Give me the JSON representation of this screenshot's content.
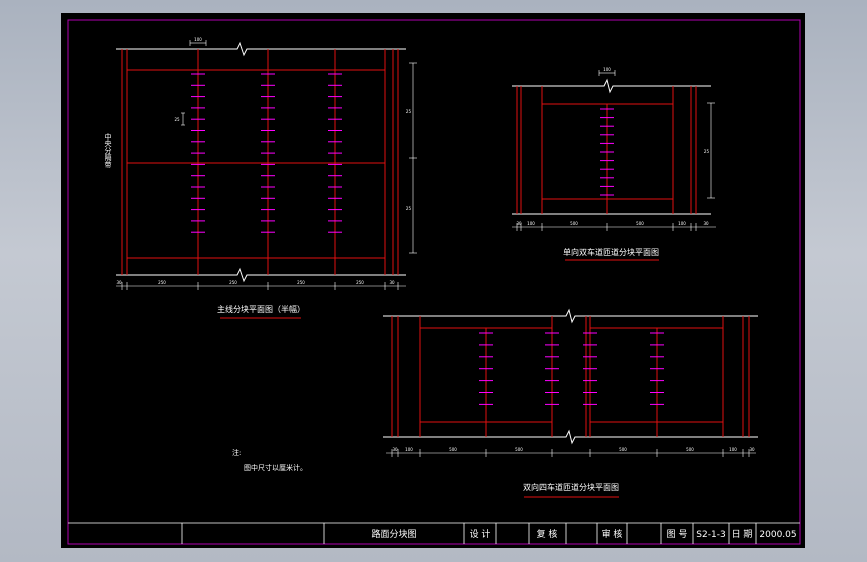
{
  "colors": {
    "background": "#000000",
    "border": "#b000b0",
    "structure": "#e01010",
    "bolts": "#ff00ff",
    "white": "#ffffff"
  },
  "drawings": {
    "main": {
      "caption": "主线分块平面图（半幅）",
      "side_label": "中央分隔带",
      "bolt_spacing_label": "25",
      "top_label": "100",
      "right_dims": [
        "25",
        "25"
      ],
      "bottom_dims": [
        "30",
        "250",
        "250",
        "250",
        "250",
        "30"
      ]
    },
    "single": {
      "caption": "单向双车道匝道分块平面图",
      "top_label": "100",
      "right_dim": "25",
      "bottom_dims": [
        "30",
        "100",
        "500",
        "500",
        "100",
        "30"
      ]
    },
    "double": {
      "caption": "双向四车道匝道分块平面图",
      "bottom_dims": [
        "30",
        "100",
        "500",
        "500",
        "500",
        "500",
        "100",
        "30"
      ]
    }
  },
  "notes": {
    "heading": "注:",
    "line1": "图中尺寸以厘米计。"
  },
  "title_block": {
    "title": "路面分块图",
    "design": "设 计",
    "review": "复 核",
    "audit": "审 核",
    "drawing_no_label": "图 号",
    "drawing_no": "S2-1-3",
    "date_label": "日 期",
    "date": "2000.05"
  }
}
